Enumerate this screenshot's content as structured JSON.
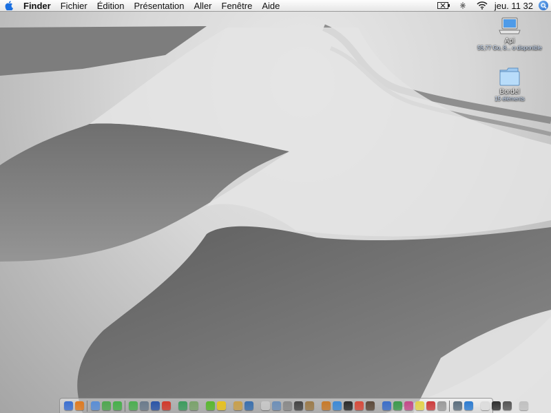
{
  "menubar": {
    "apple_icon": "apple-icon",
    "app_name": "Finder",
    "menus": [
      "Fichier",
      "Édition",
      "Présentation",
      "Aller",
      "Fenêtre",
      "Aide"
    ],
    "status_icons": [
      "battery-icon",
      "bluetooth-icon",
      "wifi-icon"
    ],
    "clock": "jeu. 11 32",
    "spotlight_icon": "spotlight-search-icon"
  },
  "desktop": {
    "wallpaper": "grayscale snow dunes",
    "icons": [
      {
        "name": "Api",
        "info": "55,77 Go, 8... o disponible",
        "icon": "laptop-drive-icon"
      },
      {
        "name": "Bordel",
        "info": "15 éléments",
        "icon": "folder-icon"
      }
    ]
  },
  "dock": {
    "items": [
      {
        "name": "finder-icon",
        "color": "#3b6fd1"
      },
      {
        "name": "firefox-icon",
        "color": "#e07a1f"
      },
      {
        "name": "sep"
      },
      {
        "name": "preview-icon",
        "color": "#5a8ed6"
      },
      {
        "name": "ichat-icon",
        "color": "#4fa84f"
      },
      {
        "name": "skype-icon",
        "color": "#46b04a"
      },
      {
        "name": "sep"
      },
      {
        "name": "growl-icon",
        "color": "#4caf50"
      },
      {
        "name": "vlc-icon",
        "color": "#6b7b8c"
      },
      {
        "name": "globe-icon",
        "color": "#2b55a8"
      },
      {
        "name": "tomato-icon",
        "color": "#d23a2a"
      },
      {
        "name": "gap"
      },
      {
        "name": "itunes-icon",
        "color": "#3d9c5e"
      },
      {
        "name": "photos-icon",
        "color": "#7aa36b"
      },
      {
        "name": "gap"
      },
      {
        "name": "adium-icon",
        "color": "#58b82f"
      },
      {
        "name": "duck-icon",
        "color": "#e8c21d"
      },
      {
        "name": "gap"
      },
      {
        "name": "hands-icon",
        "color": "#c9a04b"
      },
      {
        "name": "network-icon",
        "color": "#3a6fae"
      },
      {
        "name": "gap"
      },
      {
        "name": "textedit-icon",
        "color": "#c8c8c8"
      },
      {
        "name": "mail-icon",
        "color": "#6d8fb8"
      },
      {
        "name": "sysprefs-icon",
        "color": "#8a8a8a"
      },
      {
        "name": "terminal-icon",
        "color": "#444444"
      },
      {
        "name": "address-book-icon",
        "color": "#9c7b4a"
      },
      {
        "name": "gap"
      },
      {
        "name": "automator-icon",
        "color": "#c87a2a"
      },
      {
        "name": "safari-icon",
        "color": "#3c8ad8"
      },
      {
        "name": "dashboard-icon",
        "color": "#2b2b2b"
      },
      {
        "name": "calendar-icon",
        "color": "#d84a3a"
      },
      {
        "name": "dictionary-icon",
        "color": "#5d4a3a"
      },
      {
        "name": "gap"
      },
      {
        "name": "word-icon",
        "color": "#3b6ec9"
      },
      {
        "name": "excel-icon",
        "color": "#3c9a4c"
      },
      {
        "name": "filemaker-icon",
        "color": "#c44a8a"
      },
      {
        "name": "stickies-icon",
        "color": "#e3d24b"
      },
      {
        "name": "ical-icon",
        "color": "#cc3c3c"
      },
      {
        "name": "disk-utility-icon",
        "color": "#9a9a9a"
      },
      {
        "name": "sep"
      },
      {
        "name": "timemachine-icon",
        "color": "#5b6e7e"
      },
      {
        "name": "itunes-blue-icon",
        "color": "#2c7bd0"
      },
      {
        "name": "gap"
      },
      {
        "name": "document-icon",
        "color": "#dcdcdc"
      },
      {
        "name": "display-icon",
        "color": "#303030"
      },
      {
        "name": "window-icon",
        "color": "#555555"
      },
      {
        "name": "gap"
      },
      {
        "name": "trash-icon",
        "color": "#c0c0c0"
      }
    ]
  }
}
